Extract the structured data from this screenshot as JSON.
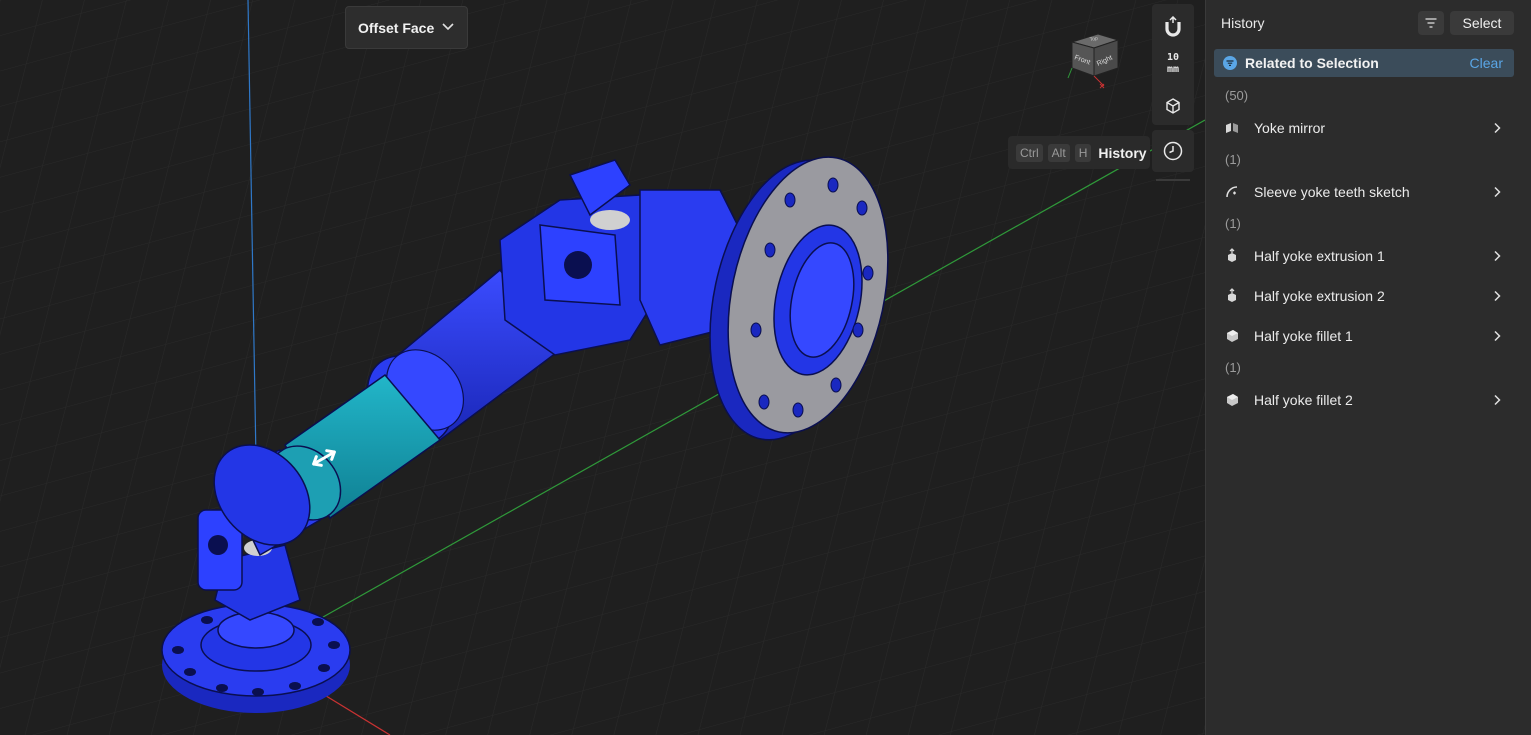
{
  "command": {
    "label": "Offset Face",
    "icon": "chevron-down-icon"
  },
  "toolbar": {
    "snap_icon": "magnet-icon",
    "grid_value": "10",
    "grid_unit": "mm",
    "view_icon": "cube-view-icon",
    "history_icon": "clock-icon"
  },
  "tooltip": {
    "keys": [
      "Ctrl",
      "Alt",
      "H"
    ],
    "label": "History"
  },
  "view_cube": {
    "front": "Front",
    "right": "Right",
    "top": "Top"
  },
  "history_panel": {
    "title": "History",
    "filter_icon": "filter-icon",
    "select_label": "Select",
    "related": {
      "label": "Related to Selection",
      "clear_label": "Clear"
    },
    "entries": [
      {
        "count": "(50)"
      },
      {
        "label": "Yoke mirror",
        "icon": "mirror-icon"
      },
      {
        "count": "(1)"
      },
      {
        "label": "Sleeve yoke teeth sketch",
        "icon": "sketch-icon"
      },
      {
        "count": "(1)"
      },
      {
        "label": "Half yoke extrusion 1",
        "icon": "extrusion-icon"
      },
      {
        "label": "Half yoke extrusion 2",
        "icon": "extrusion-icon"
      },
      {
        "label": "Half yoke fillet 1",
        "icon": "fillet-icon"
      },
      {
        "count": "(1)"
      },
      {
        "label": "Half yoke fillet 2",
        "icon": "fillet-icon"
      }
    ]
  },
  "colors": {
    "model_blue": "#2336e6",
    "selected_teal": "#17a3b8",
    "flange_face": "#9a9aa0",
    "accent_link": "#5aa6e6",
    "related_bg": "#3b4c5a"
  }
}
